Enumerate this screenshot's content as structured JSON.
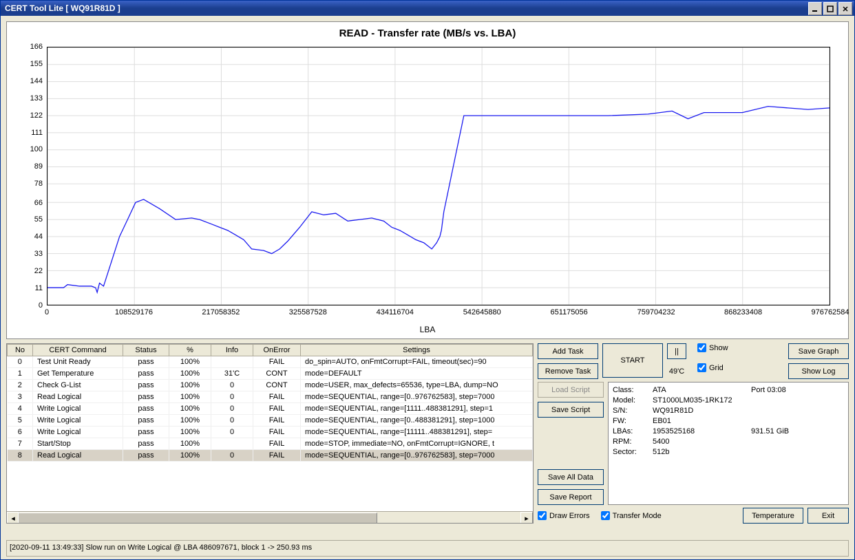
{
  "window": {
    "title": "CERT Tool Lite [ WQ91R81D ]"
  },
  "chart_data": {
    "type": "line",
    "title": "READ - Transfer rate (MB/s vs. LBA)",
    "xlabel": "LBA",
    "ylabel": "",
    "xlim": [
      0,
      976762584
    ],
    "ylim": [
      0,
      166
    ],
    "x_ticks": [
      0,
      108529176,
      217058352,
      325587528,
      434116704,
      542645880,
      651175056,
      759704232,
      868233408,
      976762584
    ],
    "y_ticks": [
      0,
      11,
      22,
      33,
      44,
      55,
      66,
      78,
      89,
      100,
      111,
      122,
      133,
      144,
      155,
      166
    ],
    "series": [
      {
        "name": "Transfer rate",
        "color": "#1a1af0",
        "x": [
          0,
          20000000,
          25000000,
          40000000,
          55000000,
          60000000,
          62000000,
          65000000,
          70000000,
          90000000,
          100000000,
          110000000,
          120000000,
          140000000,
          160000000,
          180000000,
          190000000,
          205000000,
          215000000,
          225000000,
          235000000,
          245000000,
          255000000,
          270000000,
          280000000,
          290000000,
          300000000,
          315000000,
          330000000,
          345000000,
          360000000,
          375000000,
          390000000,
          405000000,
          420000000,
          430000000,
          440000000,
          450000000,
          460000000,
          470000000,
          475000000,
          480000000,
          486000000,
          490000000,
          492000000,
          495000000,
          520000000,
          560000000,
          600000000,
          650000000,
          700000000,
          750000000,
          780000000,
          800000000,
          820000000,
          868000000,
          900000000,
          950000000,
          976762584
        ],
        "values": [
          11,
          11,
          13,
          12,
          12,
          11,
          8,
          14,
          12,
          44,
          55,
          66,
          68,
          62,
          55,
          56,
          55,
          52,
          50,
          48,
          45,
          42,
          36,
          35,
          33,
          36,
          41,
          50,
          60,
          58,
          59,
          54,
          55,
          56,
          54,
          50,
          48,
          45,
          42,
          40,
          38,
          36,
          40,
          44,
          48,
          60,
          122,
          122,
          122,
          122,
          122,
          123,
          125,
          120,
          124,
          124,
          128,
          126,
          127
        ]
      }
    ]
  },
  "table": {
    "headers": [
      "No",
      "CERT Command",
      "Status",
      "%",
      "Info",
      "OnError",
      "Settings"
    ],
    "rows": [
      {
        "no": "0",
        "cmd": "Test Unit Ready",
        "status": "pass",
        "pct": "100%",
        "info": "",
        "onerr": "FAIL",
        "settings": "do_spin=AUTO, onFmtCorrupt=FAIL, timeout(sec)=90"
      },
      {
        "no": "1",
        "cmd": "Get Temperature",
        "status": "pass",
        "pct": "100%",
        "info": "31'C",
        "onerr": "CONT",
        "settings": "mode=DEFAULT"
      },
      {
        "no": "2",
        "cmd": "Check G-List",
        "status": "pass",
        "pct": "100%",
        "info": "0",
        "onerr": "CONT",
        "settings": "mode=USER, max_defects=65536, type=LBA, dump=NO"
      },
      {
        "no": "3",
        "cmd": "Read Logical",
        "status": "pass",
        "pct": "100%",
        "info": "0",
        "onerr": "FAIL",
        "settings": "mode=SEQUENTIAL, range=[0..976762583], step=7000"
      },
      {
        "no": "4",
        "cmd": "Write Logical",
        "status": "pass",
        "pct": "100%",
        "info": "0",
        "onerr": "FAIL",
        "settings": "mode=SEQUENTIAL, range=[1111..488381291], step=1"
      },
      {
        "no": "5",
        "cmd": "Write Logical",
        "status": "pass",
        "pct": "100%",
        "info": "0",
        "onerr": "FAIL",
        "settings": "mode=SEQUENTIAL, range=[0..488381291], step=1000"
      },
      {
        "no": "6",
        "cmd": "Write Logical",
        "status": "pass",
        "pct": "100%",
        "info": "0",
        "onerr": "FAIL",
        "settings": "mode=SEQUENTIAL, range=[11111..488381291], step="
      },
      {
        "no": "7",
        "cmd": "Start/Stop",
        "status": "pass",
        "pct": "100%",
        "info": "",
        "onerr": "FAIL",
        "settings": "mode=STOP, immediate=NO, onFmtCorrupt=IGNORE, t"
      },
      {
        "no": "8",
        "cmd": "Read Logical",
        "status": "pass",
        "pct": "100%",
        "info": "0",
        "onerr": "FAIL",
        "settings": "mode=SEQUENTIAL, range=[0..976762583], step=7000",
        "selected": true
      }
    ]
  },
  "buttons": {
    "add_task": "Add Task",
    "remove_task": "Remove Task",
    "start": "START",
    "pause": "||",
    "load_script": "Load Script",
    "save_script": "Save Script",
    "save_all_data": "Save All Data",
    "save_report": "Save Report",
    "save_graph": "Save Graph",
    "show_log": "Show Log",
    "temperature": "Temperature",
    "exit": "Exit"
  },
  "checkboxes": {
    "show": "Show",
    "grid": "Grid",
    "draw_errors": "Draw Errors",
    "transfer_mode": "Transfer Mode"
  },
  "temp_display": "49'C",
  "drive_info": {
    "class_label": "Class:",
    "class_val": "ATA",
    "port": "Port 03:08",
    "model_label": "Model:",
    "model_val": "ST1000LM035-1RK172",
    "sn_label": "S/N:",
    "sn_val": "WQ91R81D",
    "fw_label": "FW:",
    "fw_val": "EB01",
    "lbas_label": "LBAs:",
    "lbas_val": "1953525168",
    "capacity": "931.51 GiB",
    "rpm_label": "RPM:",
    "rpm_val": "5400",
    "sector_label": "Sector:",
    "sector_val": "512b"
  },
  "status_bar": "[2020-09-11 13:49:33] Slow run on Write Logical @ LBA 486097671, block 1 -> 250.93 ms"
}
